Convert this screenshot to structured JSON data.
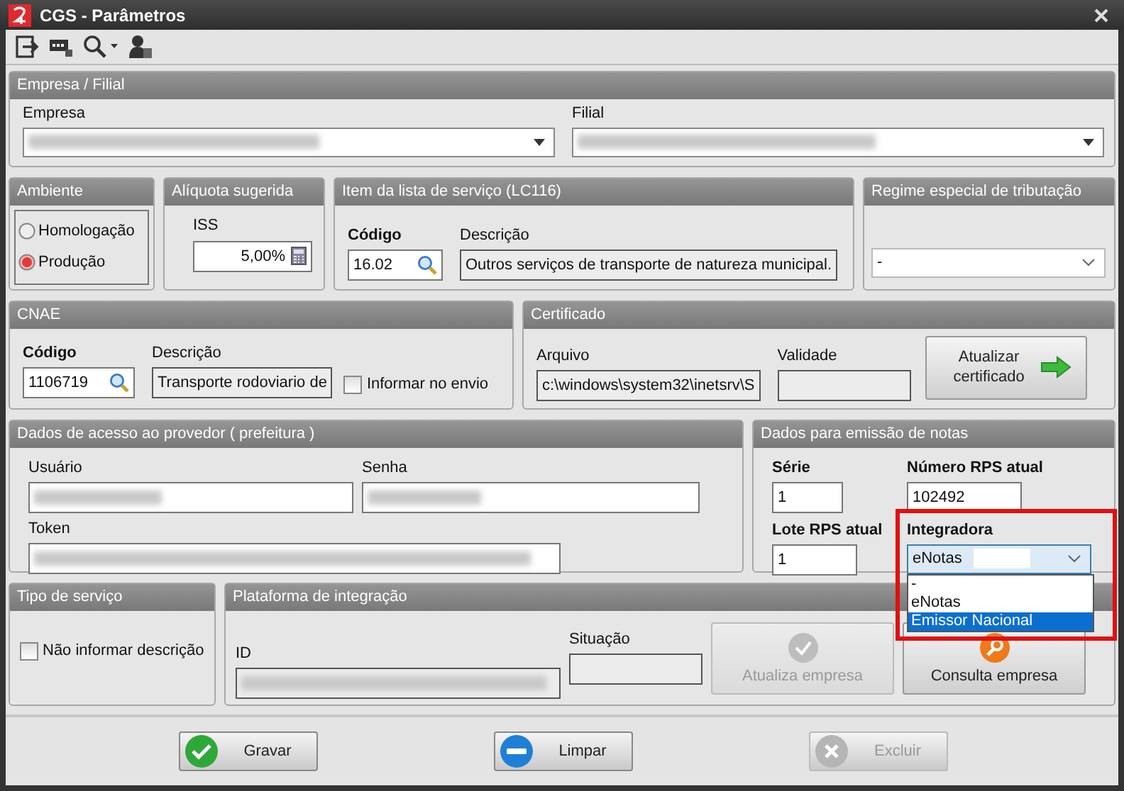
{
  "window": {
    "title": "CGS - Parâmetros"
  },
  "empresa_filial": {
    "title": "Empresa / Filial",
    "empresa_label": "Empresa",
    "filial_label": "Filial"
  },
  "ambiente": {
    "title": "Ambiente",
    "options": [
      {
        "label": "Homologação",
        "selected": false
      },
      {
        "label": "Produção",
        "selected": true
      }
    ]
  },
  "aliquota": {
    "title": "Alíquota sugerida",
    "label": "ISS",
    "value": "5,00%"
  },
  "item_lista": {
    "title": "Item da lista de serviço (LC116)",
    "codigo_label": "Código",
    "codigo": "16.02",
    "descricao_label": "Descrição",
    "descricao": "Outros serviços de transporte de natureza municipal."
  },
  "regime": {
    "title": "Regime especial de tributação",
    "value": "-"
  },
  "cnae": {
    "title": "CNAE",
    "codigo_label": "Código",
    "codigo": "1106719",
    "descricao_label": "Descrição",
    "descricao": "Transporte rodoviario de",
    "informar": {
      "label": "Informar no envio",
      "checked": false
    }
  },
  "certificado": {
    "title": "Certificado",
    "arquivo_label": "Arquivo",
    "arquivo": "c:\\windows\\system32\\inetsrv\\S",
    "validade_label": "Validade",
    "button": "Atualizar certificado"
  },
  "acesso": {
    "title": "Dados de acesso ao provedor ( prefeitura )",
    "usuario_label": "Usuário",
    "senha_label": "Senha",
    "token_label": "Token"
  },
  "emissao": {
    "title": "Dados para emissão de notas",
    "serie_label": "Série",
    "serie": "1",
    "numero_label": "Número RPS atual",
    "numero": "102492",
    "lote_label": "Lote RPS atual",
    "lote": "1",
    "integradora_label": "Integradora",
    "integradora": "eNotas",
    "options": [
      {
        "label": "-",
        "selected": false
      },
      {
        "label": "eNotas",
        "selected": false
      },
      {
        "label": "Emissor Nacional",
        "selected": true
      }
    ]
  },
  "tipo_servico": {
    "title": "Tipo de serviço",
    "nao_informar": {
      "label": "Não informar descrição",
      "checked": false
    }
  },
  "plataforma": {
    "title": "Plataforma de integração",
    "id_label": "ID",
    "situacao_label": "Situação",
    "buttons": [
      {
        "label": "Atualiza empresa",
        "kind": "check",
        "disabled": true
      },
      {
        "label": "Consulta empresa",
        "kind": "search",
        "disabled": false
      }
    ]
  },
  "footer_buttons": [
    {
      "label": "Gravar",
      "kind": "save",
      "disabled": false
    },
    {
      "label": "Limpar",
      "kind": "clear",
      "disabled": false
    },
    {
      "label": "Excluir",
      "kind": "delete",
      "disabled": true
    }
  ]
}
